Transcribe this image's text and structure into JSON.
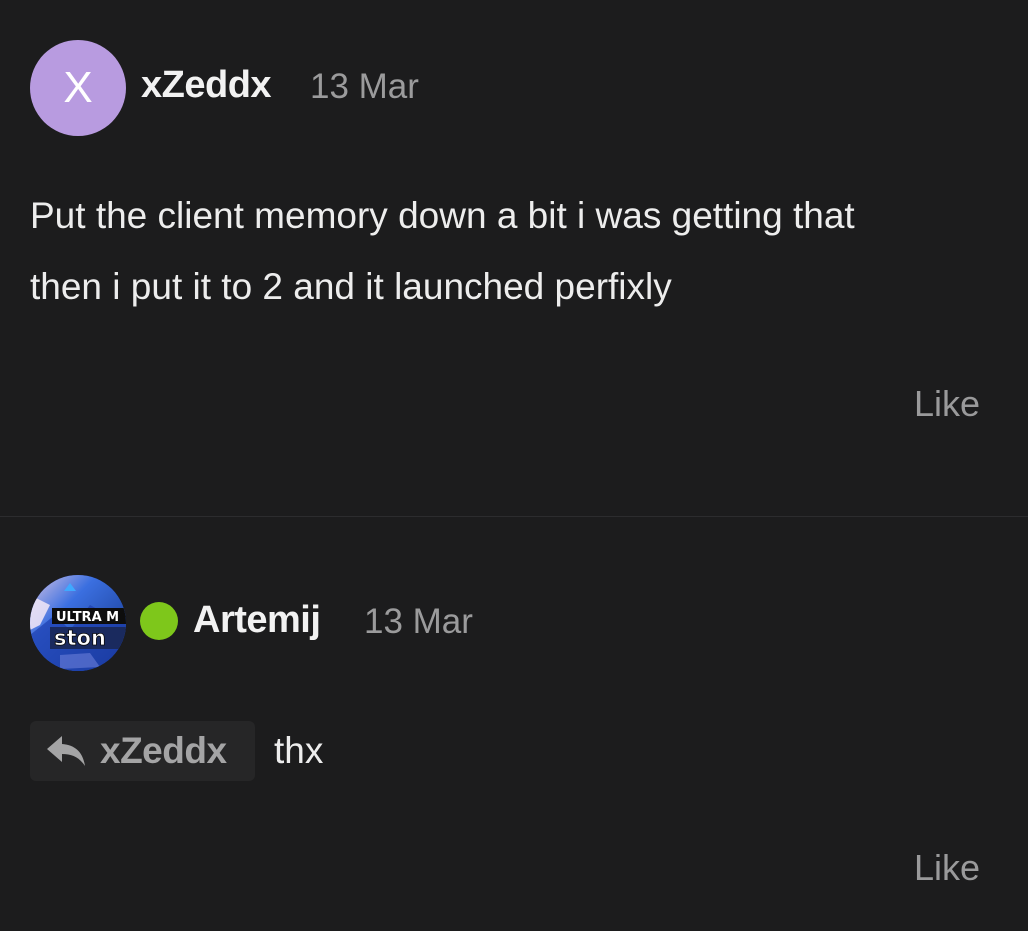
{
  "posts": [
    {
      "avatar_letter": "X",
      "avatar_color": "#b89be0",
      "username": "xZeddx",
      "date": "13 Mar",
      "body_lines": [
        "Put the client memory down a bit i was getting that",
        "then i put it to 2 and it launched perfixly"
      ],
      "like_label": "Like"
    },
    {
      "avatar_image_text": [
        "ULTRA M",
        "ston"
      ],
      "online_status_color": "#7ec71b",
      "username": "Artemij",
      "date": "13 Mar",
      "reply_to": {
        "icon": "reply-arrow-icon",
        "username": "xZeddx"
      },
      "body": "thx",
      "like_label": "Like"
    }
  ]
}
